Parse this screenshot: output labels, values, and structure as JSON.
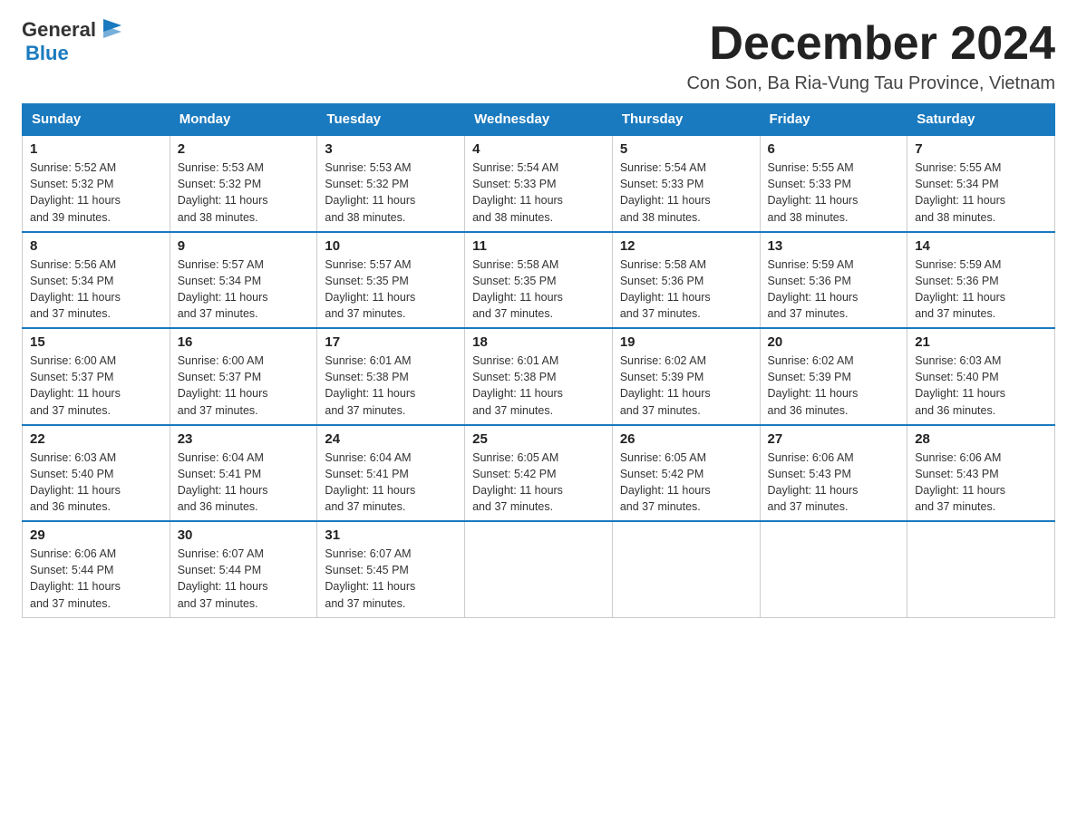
{
  "header": {
    "logo_general": "General",
    "logo_blue": "Blue",
    "title": "December 2024",
    "subtitle": "Con Son, Ba Ria-Vung Tau Province, Vietnam"
  },
  "weekdays": [
    "Sunday",
    "Monday",
    "Tuesday",
    "Wednesday",
    "Thursday",
    "Friday",
    "Saturday"
  ],
  "weeks": [
    [
      {
        "day": "1",
        "sunrise": "5:52 AM",
        "sunset": "5:32 PM",
        "daylight": "11 hours and 39 minutes."
      },
      {
        "day": "2",
        "sunrise": "5:53 AM",
        "sunset": "5:32 PM",
        "daylight": "11 hours and 38 minutes."
      },
      {
        "day": "3",
        "sunrise": "5:53 AM",
        "sunset": "5:32 PM",
        "daylight": "11 hours and 38 minutes."
      },
      {
        "day": "4",
        "sunrise": "5:54 AM",
        "sunset": "5:33 PM",
        "daylight": "11 hours and 38 minutes."
      },
      {
        "day": "5",
        "sunrise": "5:54 AM",
        "sunset": "5:33 PM",
        "daylight": "11 hours and 38 minutes."
      },
      {
        "day": "6",
        "sunrise": "5:55 AM",
        "sunset": "5:33 PM",
        "daylight": "11 hours and 38 minutes."
      },
      {
        "day": "7",
        "sunrise": "5:55 AM",
        "sunset": "5:34 PM",
        "daylight": "11 hours and 38 minutes."
      }
    ],
    [
      {
        "day": "8",
        "sunrise": "5:56 AM",
        "sunset": "5:34 PM",
        "daylight": "11 hours and 37 minutes."
      },
      {
        "day": "9",
        "sunrise": "5:57 AM",
        "sunset": "5:34 PM",
        "daylight": "11 hours and 37 minutes."
      },
      {
        "day": "10",
        "sunrise": "5:57 AM",
        "sunset": "5:35 PM",
        "daylight": "11 hours and 37 minutes."
      },
      {
        "day": "11",
        "sunrise": "5:58 AM",
        "sunset": "5:35 PM",
        "daylight": "11 hours and 37 minutes."
      },
      {
        "day": "12",
        "sunrise": "5:58 AM",
        "sunset": "5:36 PM",
        "daylight": "11 hours and 37 minutes."
      },
      {
        "day": "13",
        "sunrise": "5:59 AM",
        "sunset": "5:36 PM",
        "daylight": "11 hours and 37 minutes."
      },
      {
        "day": "14",
        "sunrise": "5:59 AM",
        "sunset": "5:36 PM",
        "daylight": "11 hours and 37 minutes."
      }
    ],
    [
      {
        "day": "15",
        "sunrise": "6:00 AM",
        "sunset": "5:37 PM",
        "daylight": "11 hours and 37 minutes."
      },
      {
        "day": "16",
        "sunrise": "6:00 AM",
        "sunset": "5:37 PM",
        "daylight": "11 hours and 37 minutes."
      },
      {
        "day": "17",
        "sunrise": "6:01 AM",
        "sunset": "5:38 PM",
        "daylight": "11 hours and 37 minutes."
      },
      {
        "day": "18",
        "sunrise": "6:01 AM",
        "sunset": "5:38 PM",
        "daylight": "11 hours and 37 minutes."
      },
      {
        "day": "19",
        "sunrise": "6:02 AM",
        "sunset": "5:39 PM",
        "daylight": "11 hours and 37 minutes."
      },
      {
        "day": "20",
        "sunrise": "6:02 AM",
        "sunset": "5:39 PM",
        "daylight": "11 hours and 36 minutes."
      },
      {
        "day": "21",
        "sunrise": "6:03 AM",
        "sunset": "5:40 PM",
        "daylight": "11 hours and 36 minutes."
      }
    ],
    [
      {
        "day": "22",
        "sunrise": "6:03 AM",
        "sunset": "5:40 PM",
        "daylight": "11 hours and 36 minutes."
      },
      {
        "day": "23",
        "sunrise": "6:04 AM",
        "sunset": "5:41 PM",
        "daylight": "11 hours and 36 minutes."
      },
      {
        "day": "24",
        "sunrise": "6:04 AM",
        "sunset": "5:41 PM",
        "daylight": "11 hours and 37 minutes."
      },
      {
        "day": "25",
        "sunrise": "6:05 AM",
        "sunset": "5:42 PM",
        "daylight": "11 hours and 37 minutes."
      },
      {
        "day": "26",
        "sunrise": "6:05 AM",
        "sunset": "5:42 PM",
        "daylight": "11 hours and 37 minutes."
      },
      {
        "day": "27",
        "sunrise": "6:06 AM",
        "sunset": "5:43 PM",
        "daylight": "11 hours and 37 minutes."
      },
      {
        "day": "28",
        "sunrise": "6:06 AM",
        "sunset": "5:43 PM",
        "daylight": "11 hours and 37 minutes."
      }
    ],
    [
      {
        "day": "29",
        "sunrise": "6:06 AM",
        "sunset": "5:44 PM",
        "daylight": "11 hours and 37 minutes."
      },
      {
        "day": "30",
        "sunrise": "6:07 AM",
        "sunset": "5:44 PM",
        "daylight": "11 hours and 37 minutes."
      },
      {
        "day": "31",
        "sunrise": "6:07 AM",
        "sunset": "5:45 PM",
        "daylight": "11 hours and 37 minutes."
      },
      null,
      null,
      null,
      null
    ]
  ],
  "labels": {
    "sunrise": "Sunrise:",
    "sunset": "Sunset:",
    "daylight": "Daylight:"
  }
}
